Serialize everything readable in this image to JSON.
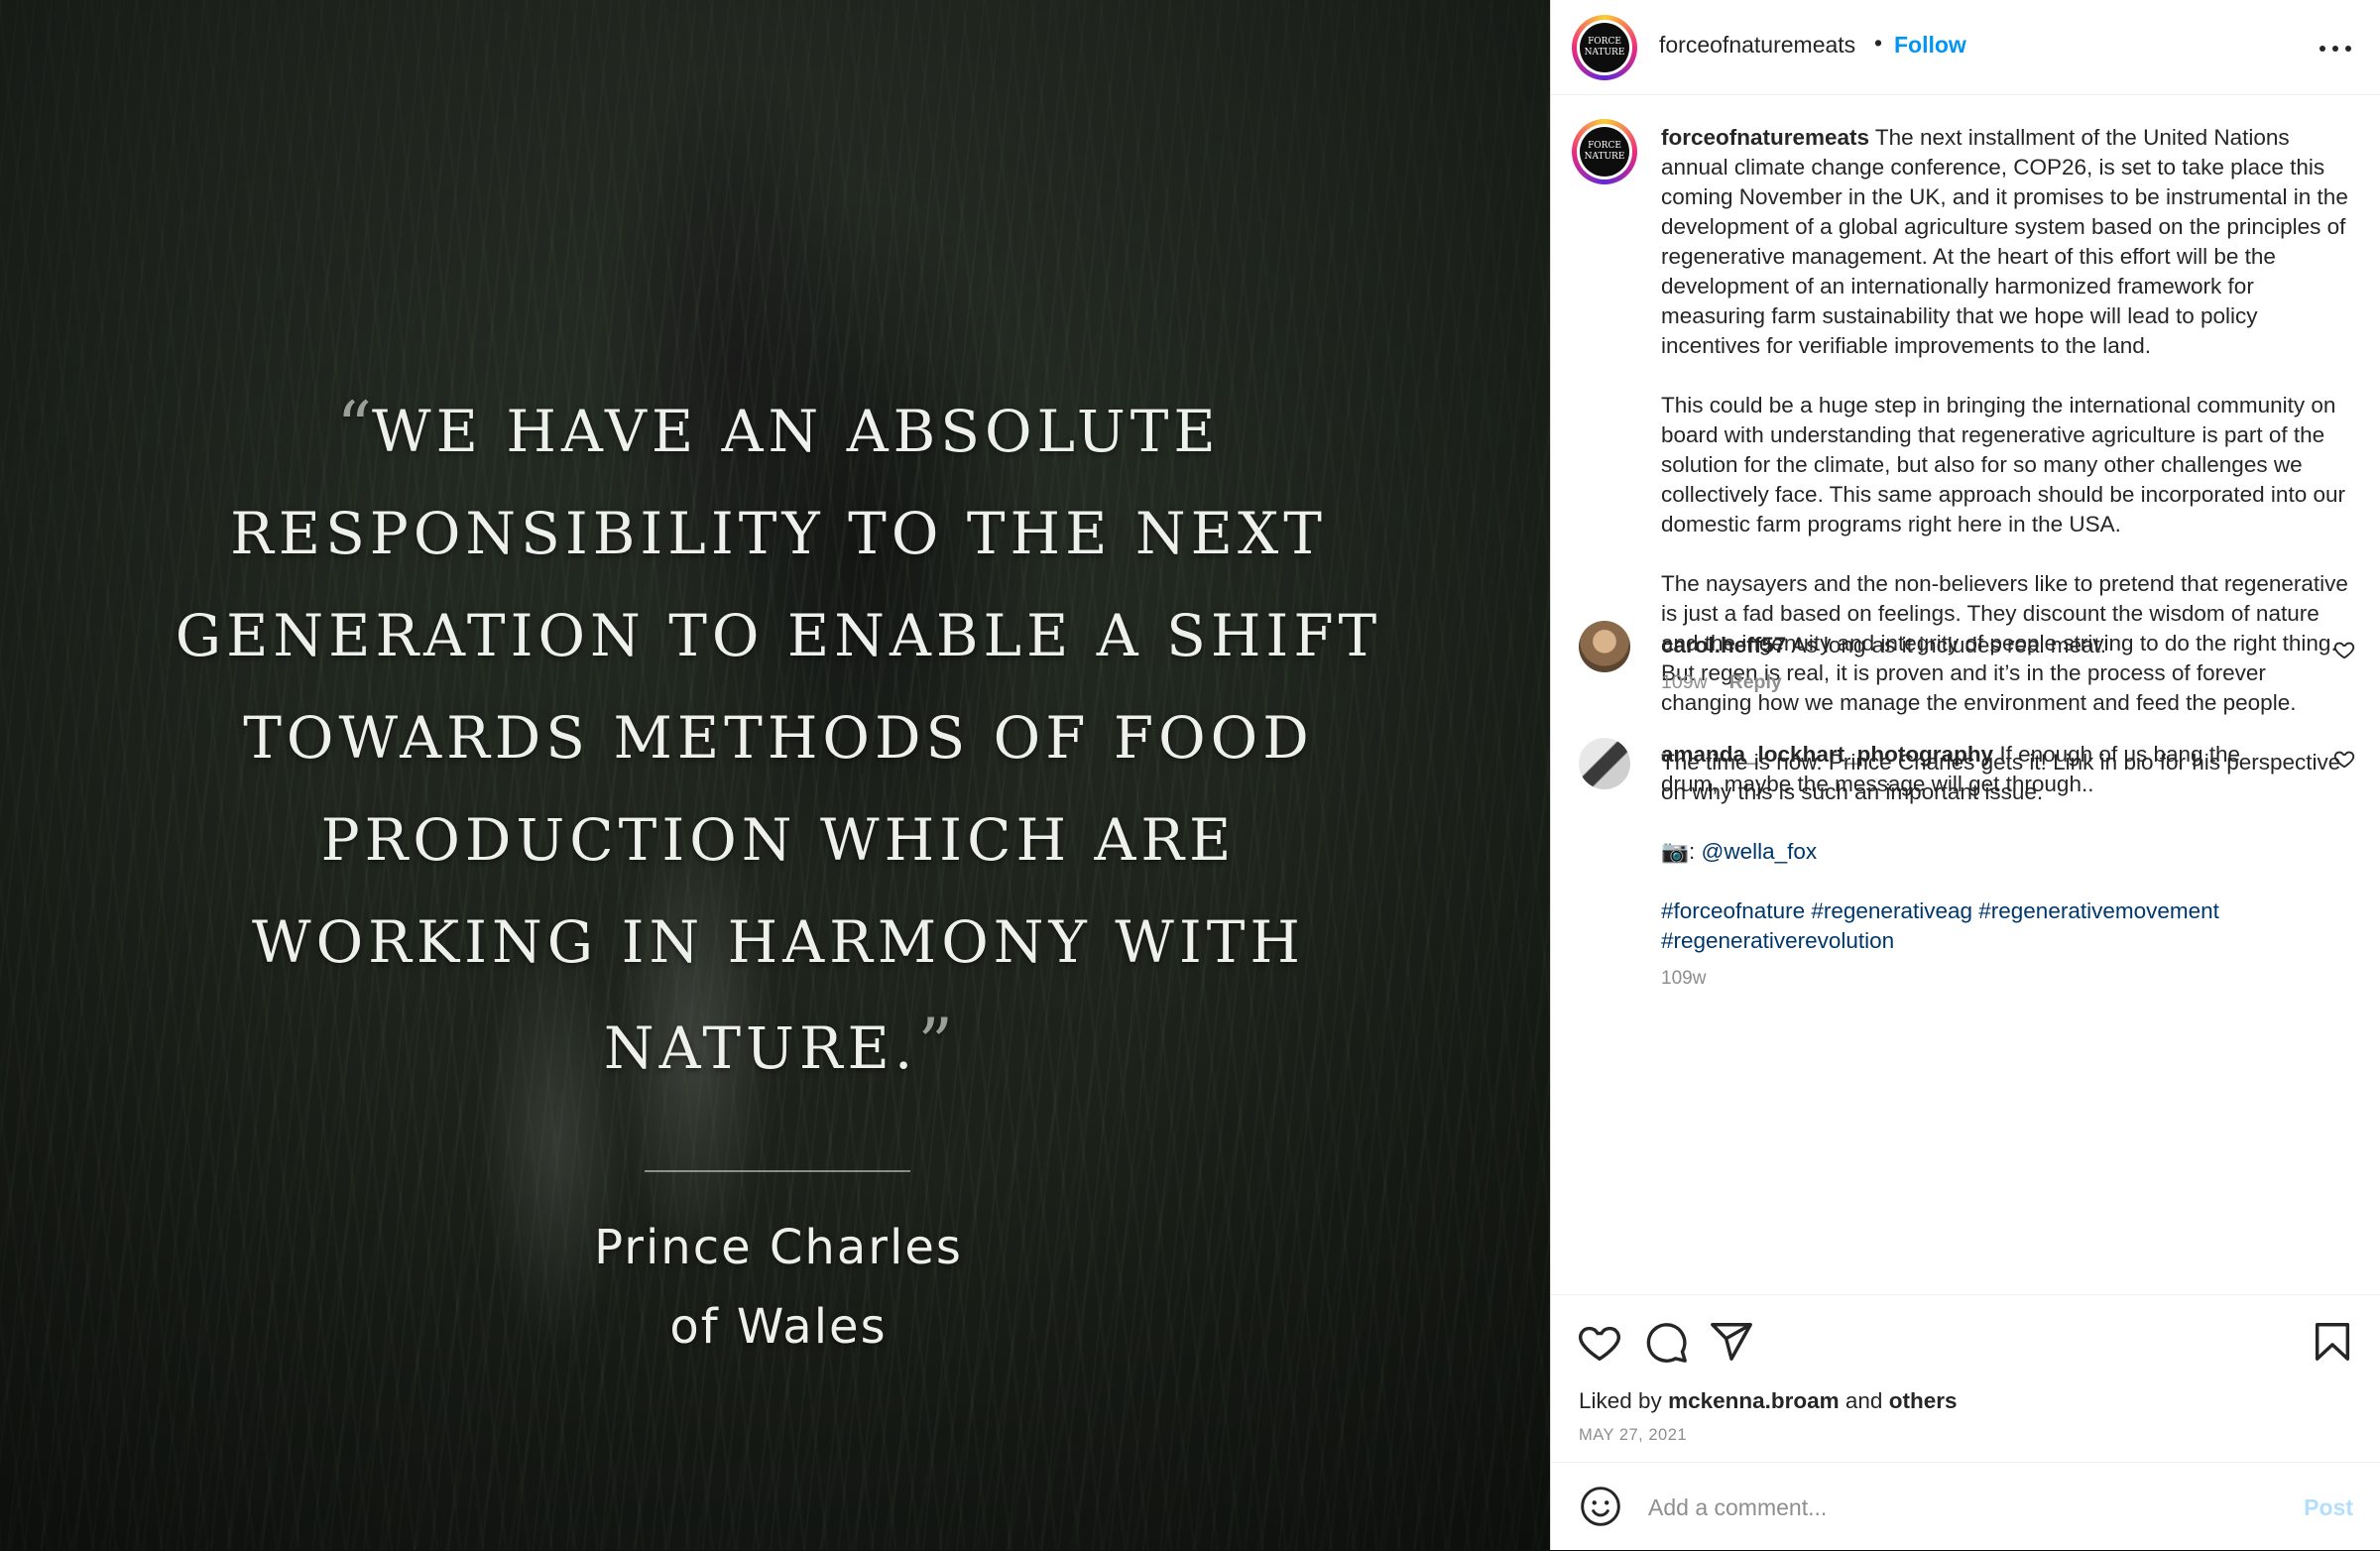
{
  "media": {
    "quote_open": "“",
    "quote": "WE HAVE AN ABSOLUTE RESPONSIBILITY TO THE NEXT GENERATION TO ENABLE A SHIFT TOWARDS METHODS OF FOOD PRODUCTION WHICH ARE WORKING IN HARMONY WITH NATURE.",
    "quote_close": "”",
    "attribution_line1": "Prince Charles",
    "attribution_line2": "of Wales"
  },
  "header": {
    "username": "forceofnaturemeats",
    "separator": "•",
    "follow_label": "Follow",
    "avatar_text": "FORCE NATURE",
    "more_icon": "more-horizontal-icon"
  },
  "caption": {
    "username": "forceofnaturemeats",
    "paragraph1": "The next installment of the United Nations annual climate change conference, COP26, is set to take place this coming November in the UK, and it promises to be instrumental in the development of a global agriculture system based on the principles of regenerative management. At the heart of this effort will be the development of an internationally harmonized framework for measuring farm sustainability that we hope will lead to policy incentives for verifiable improvements to the land.",
    "paragraph2": "This could be a huge step in bringing the international community on board with understanding that regenerative agriculture is part of the solution for the climate, but also for so many other challenges we collectively face. This same approach should be incorporated into our domestic farm programs right here in the USA.",
    "paragraph3": "The naysayers and the non-believers like to pretend that regenerative is just a fad based on feelings. They discount the wisdom of nature and the ingenuity and integrity of people striving to do the right thing. But regen is real, it is proven and it’s in the process of forever changing how we manage the environment and feed the people.",
    "paragraph4": "The time is now. Prince Charles gets it! Link in bio for his perspective on why this is such an important issue.",
    "photo_credit_prefix": "📷: ",
    "photo_credit_handle": "@wella_fox",
    "hashtags": [
      "#forceofnature",
      "#regenerativeag",
      "#regenerativemovement",
      "#regenerativerevolution"
    ],
    "age": "109w"
  },
  "comments": [
    {
      "username": "carol.heff57",
      "text": "As long as it includes real meat.",
      "age": "109w",
      "reply_label": "Reply"
    },
    {
      "username": "amanda_lockhart_photography",
      "text": "If enough of us bang the drum, maybe the message will get through.."
    }
  ],
  "actions": {
    "icons": [
      "heart-icon",
      "comment-icon",
      "share-icon",
      "bookmark-icon"
    ],
    "liked_by_prefix": "Liked by",
    "liked_by_user": "mckenna.broam",
    "liked_by_and": "and",
    "liked_by_others": "others",
    "date": "MAY 27, 2021"
  },
  "add_comment": {
    "placeholder": "Add a comment...",
    "post_label": "Post"
  },
  "colors": {
    "follow": "#0095f6",
    "link": "#00376b",
    "muted": "#8e8e8e",
    "post_disabled": "#b2dffc"
  }
}
